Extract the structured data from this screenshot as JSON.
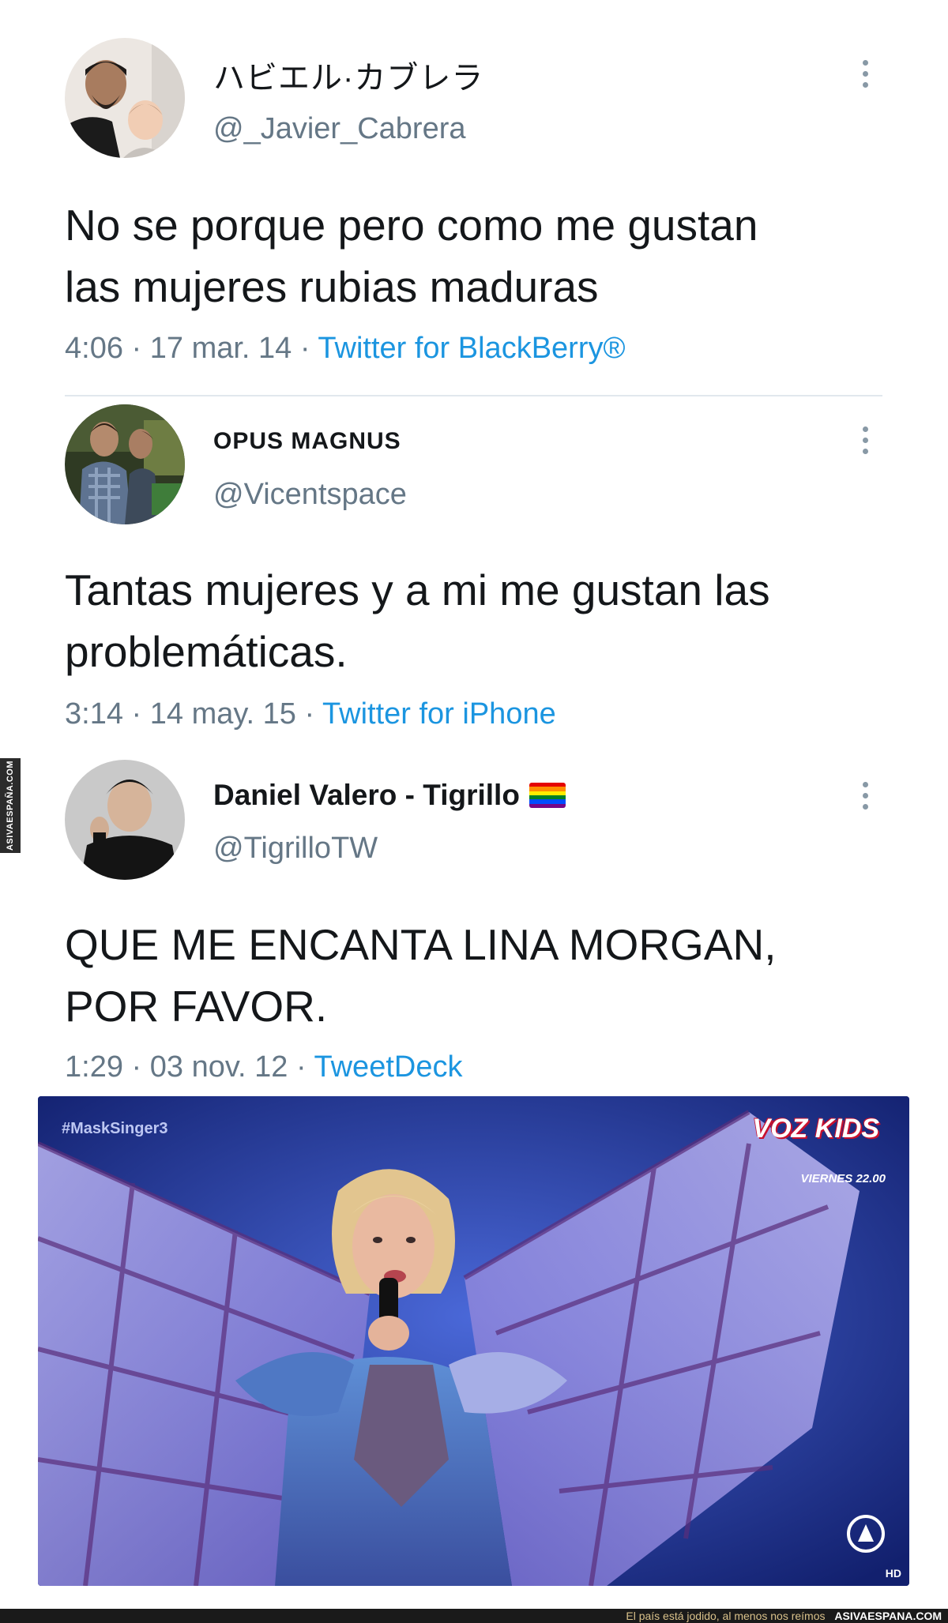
{
  "tweets": [
    {
      "display_name": "ハビエル·カブレラ",
      "handle": "@_Javier_Cabrera",
      "text_lines": [
        "No se porque pero como me gustan",
        "las mujeres rubias maduras"
      ],
      "time": "4:06",
      "date": "17 mar. 14",
      "source": "Twitter for BlackBerry®"
    },
    {
      "display_name": "OPUS MAGNUS",
      "handle": "@Vicentspace",
      "text_lines": [
        "Tantas mujeres y a mi me gustan las",
        "problemáticas."
      ],
      "time": "3:14",
      "date": "14 may. 15",
      "source": "Twitter for iPhone"
    },
    {
      "display_name": "Daniel Valero - Tigrillo",
      "handle": "@TigrilloTW",
      "text_lines": [
        "QUE ME ENCANTA LINA MORGAN,",
        "POR FAVOR."
      ],
      "time": "1:29",
      "date": "03 nov. 12",
      "source": "TweetDeck"
    }
  ],
  "media": {
    "hashtag": "#MaskSinger3",
    "logo_text": "VOZ KIDS",
    "logo_subtitle": "VIERNES 22.00",
    "hd": "HD"
  },
  "watermark": "ASIVAESPAÑA.COM",
  "footer": {
    "tagline": "El país está jodido, al menos nos reímos",
    "site": "ASIVAESPANA.COM"
  },
  "colors": {
    "link": "#1b95e0",
    "secondary_text": "#657786",
    "divider": "#e1e8ed"
  },
  "icons": [
    "more-options-icon",
    "rainbow-flag-icon",
    "antena3-logo-icon"
  ]
}
